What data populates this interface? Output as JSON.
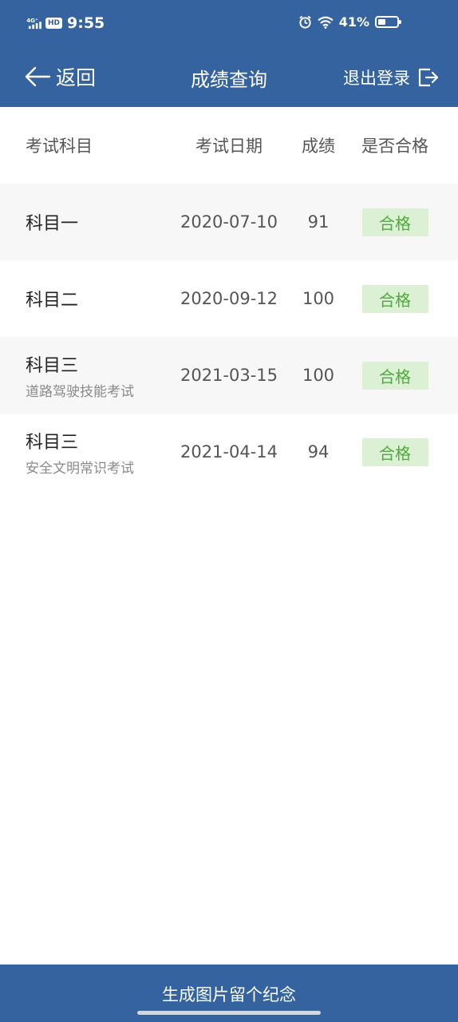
{
  "status_bar": {
    "network": "4G⁺",
    "hd": "HD",
    "time": "9:55",
    "battery": "41%",
    "icons": [
      "signal-icon",
      "alarm-icon",
      "wifi-icon",
      "battery-icon"
    ]
  },
  "header": {
    "back_label": "返回",
    "title": "成绩查询",
    "logout_label": "退出登录"
  },
  "table": {
    "columns": [
      "考试科目",
      "考试日期",
      "成绩",
      "是否合格"
    ],
    "rows": [
      {
        "subject": "科目一",
        "sub": "",
        "date": "2020-07-10",
        "score": "91",
        "status": "合格"
      },
      {
        "subject": "科目二",
        "sub": "",
        "date": "2020-09-12",
        "score": "100",
        "status": "合格"
      },
      {
        "subject": "科目三",
        "sub": "道路驾驶技能考试",
        "date": "2021-03-15",
        "score": "100",
        "status": "合格"
      },
      {
        "subject": "科目三",
        "sub": "安全文明常识考试",
        "date": "2021-04-14",
        "score": "94",
        "status": "合格"
      }
    ]
  },
  "footer": {
    "button_label": "生成图片留个纪念"
  },
  "colors": {
    "primary": "#3563a0",
    "pass_bg": "#dcf1d3",
    "pass_text": "#4caa3a",
    "row_alt": "#f7f7f7"
  }
}
